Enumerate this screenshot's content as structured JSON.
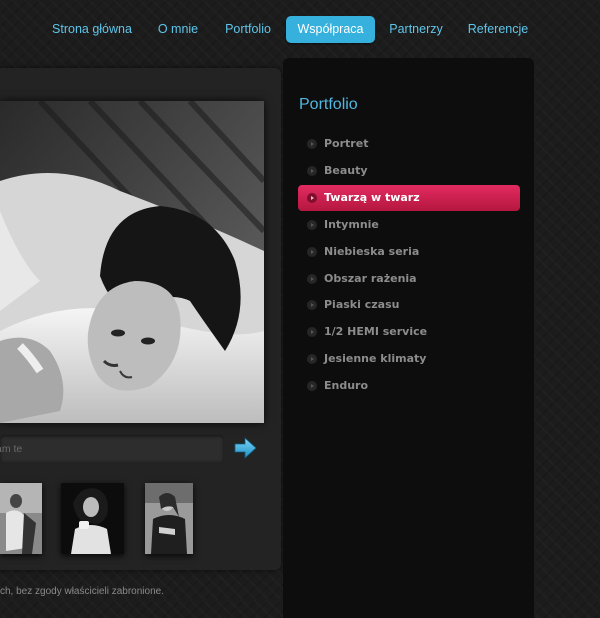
{
  "nav": {
    "items": [
      {
        "label": "Strona główna",
        "active": false
      },
      {
        "label": "O mnie",
        "active": false
      },
      {
        "label": "Portfolio",
        "active": false
      },
      {
        "label": "Współpraca",
        "active": true
      },
      {
        "label": "Partnerzy",
        "active": false
      },
      {
        "label": "Referencje",
        "active": false
      }
    ]
  },
  "gallery": {
    "comment_placeholder": "am te",
    "submit_icon": "arrow-right-icon",
    "thumbnails": [
      "thumbnail-portrait-1",
      "thumbnail-portrait-2",
      "thumbnail-portrait-3"
    ]
  },
  "sidebar": {
    "title": "Portfolio",
    "items": [
      {
        "label": "Portret",
        "active": false
      },
      {
        "label": "Beauty",
        "active": false
      },
      {
        "label": "Twarzą w twarz",
        "active": true
      },
      {
        "label": "Intymnie",
        "active": false
      },
      {
        "label": "Niebieska seria",
        "active": false
      },
      {
        "label": "Obszar rażenia",
        "active": false
      },
      {
        "label": "Piaski czasu",
        "active": false
      },
      {
        "label": "1/2 HEMI service",
        "active": false
      },
      {
        "label": "Jesienne klimaty",
        "active": false
      },
      {
        "label": "Enduro",
        "active": false
      }
    ]
  },
  "footer": {
    "text": "ch, bez zgody właścicieli zabronione."
  },
  "colors": {
    "accent_blue": "#36b1dd",
    "active_pink": "#d6245a",
    "background": "#1c1c1c"
  }
}
